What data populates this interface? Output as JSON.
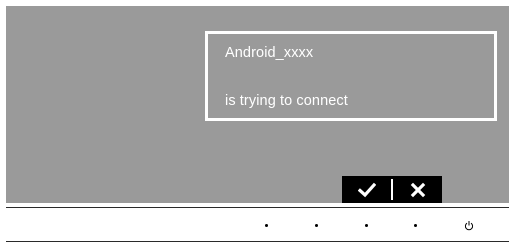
{
  "dialog": {
    "device_name": "Android_xxxx",
    "message": "is trying to connect"
  },
  "actions": {
    "accept_icon": "checkmark-icon",
    "decline_icon": "x-icon"
  },
  "bezel_keys": [
    {
      "icon": "dot-icon"
    },
    {
      "icon": "dot-icon"
    },
    {
      "icon": "dot-icon"
    },
    {
      "icon": "dot-icon"
    },
    {
      "icon": "power-icon"
    }
  ],
  "colors": {
    "screen_background": "#9a9a9a",
    "dialog_border": "#ffffff",
    "text": "#ffffff",
    "action_bar": "#000000"
  }
}
